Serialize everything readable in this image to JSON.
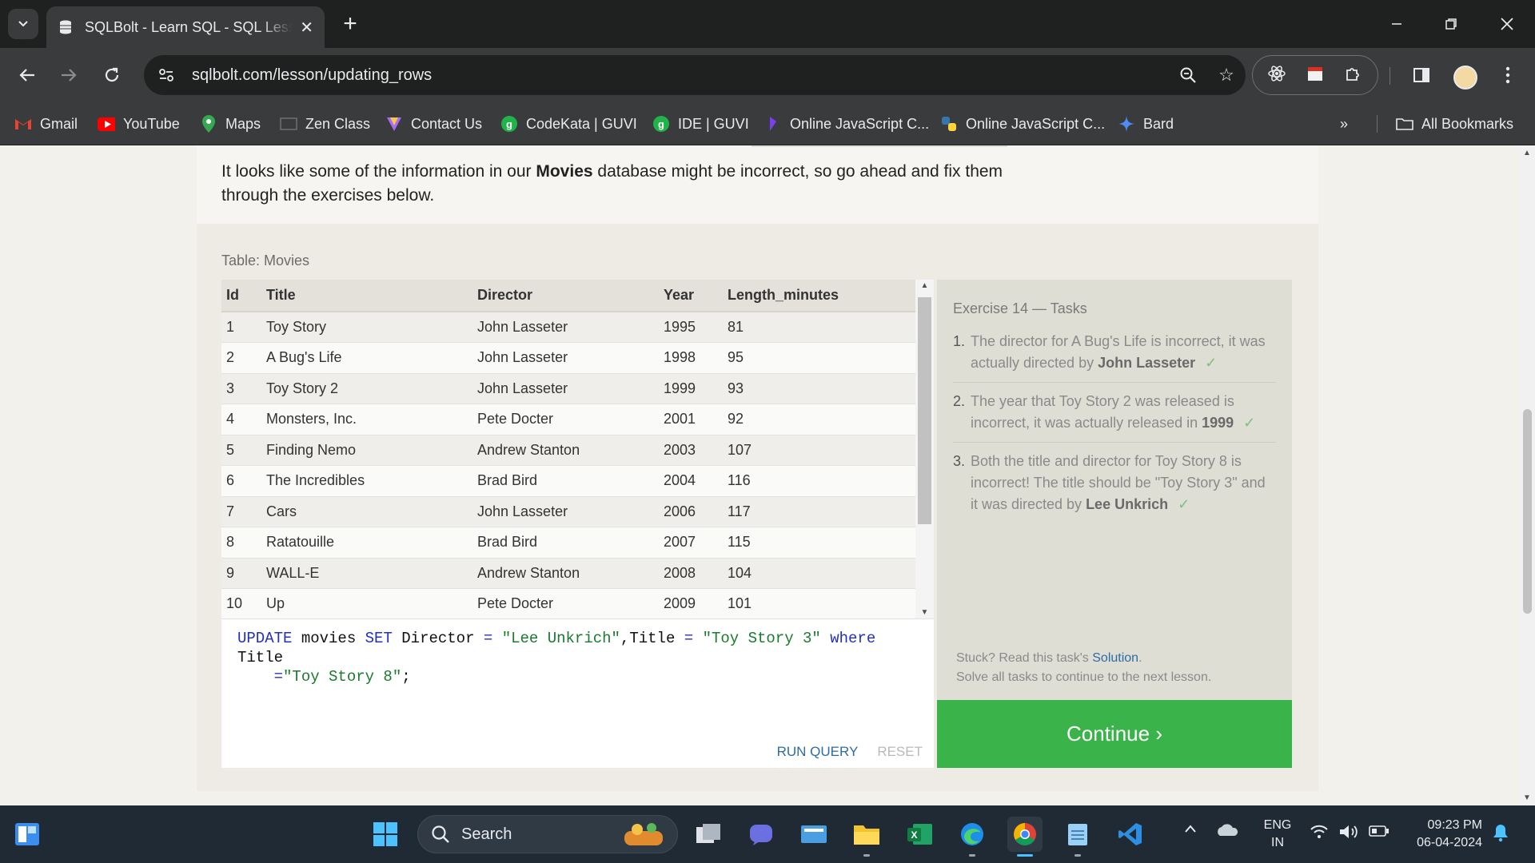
{
  "browser": {
    "tab_title": "SQLBolt - Learn SQL - SQL Lessons",
    "url": "sqlbolt.com/lesson/updating_rows"
  },
  "bookmarks": [
    {
      "label": "Gmail",
      "icon": "gmail-icon"
    },
    {
      "label": "YouTube",
      "icon": "youtube-icon"
    },
    {
      "label": "Maps",
      "icon": "maps-icon"
    },
    {
      "label": "Zen Class",
      "icon": "zen-class-icon"
    },
    {
      "label": "Contact Us",
      "icon": "contact-us-icon"
    },
    {
      "label": "CodeKata | GUVI",
      "icon": "guvi-icon"
    },
    {
      "label": "IDE | GUVI",
      "icon": "guvi-icon"
    },
    {
      "label": "Online JavaScript C...",
      "icon": "javascript-icon"
    },
    {
      "label": "Online JavaScript C...",
      "icon": "python-icon"
    },
    {
      "label": "Bard",
      "icon": "bard-icon"
    }
  ],
  "bookmarks_all": "All Bookmarks",
  "lesson": {
    "intro_before": "It looks like some of the information in our ",
    "intro_bold": "Movies",
    "intro_after": " database might be incorrect, so go ahead and fix them through the exercises below.",
    "table_caption": "Table: Movies",
    "columns": [
      "Id",
      "Title",
      "Director",
      "Year",
      "Length_minutes"
    ],
    "rows": [
      [
        "1",
        "Toy Story",
        "John Lasseter",
        "1995",
        "81"
      ],
      [
        "2",
        "A Bug's Life",
        "John Lasseter",
        "1998",
        "95"
      ],
      [
        "3",
        "Toy Story 2",
        "John Lasseter",
        "1999",
        "93"
      ],
      [
        "4",
        "Monsters, Inc.",
        "Pete Docter",
        "2001",
        "92"
      ],
      [
        "5",
        "Finding Nemo",
        "Andrew Stanton",
        "2003",
        "107"
      ],
      [
        "6",
        "The Incredibles",
        "Brad Bird",
        "2004",
        "116"
      ],
      [
        "7",
        "Cars",
        "John Lasseter",
        "2006",
        "117"
      ],
      [
        "8",
        "Ratatouille",
        "Brad Bird",
        "2007",
        "115"
      ],
      [
        "9",
        "WALL-E",
        "Andrew Stanton",
        "2008",
        "104"
      ],
      [
        "10",
        "Up",
        "Pete Docter",
        "2009",
        "101"
      ]
    ],
    "query": {
      "kw_update": "UPDATE",
      "t_movies": " movies ",
      "kw_set": "SET",
      "t_director": " Director ",
      "op1": "=",
      "s1": " \"Lee Unkrich\"",
      "t_title": ",Title ",
      "op2": "=",
      "s2": " \"Toy Story 3\"",
      "kw_where": " where",
      "t_title2": " Title\n    ",
      "op3": "=",
      "s3": "\"Toy Story 8\"",
      "t_end": ";"
    },
    "run_query": "RUN QUERY",
    "reset": "RESET",
    "exercise_title": "Exercise 14 — Tasks",
    "tasks": [
      {
        "num": "1.",
        "text": "The director for A Bug's Life is incorrect, it was actually directed by ",
        "bold": "John Lasseter",
        "check": "✓"
      },
      {
        "num": "2.",
        "text": "The year that Toy Story 2 was released is incorrect, it was actually released in ",
        "bold": "1999",
        "check": "✓"
      },
      {
        "num": "3.",
        "text": "Both the title and director for Toy Story 8 is incorrect! The title should be \"Toy Story 3\" and it was directed by ",
        "bold": "Lee Unkrich",
        "check": "✓"
      }
    ],
    "stuck_text": "Stuck? Read this task's ",
    "solution": "Solution",
    "stuck_end": ".",
    "solve_all": "Solve all tasks to continue to the next lesson.",
    "continue": "Continue ›"
  },
  "taskbar": {
    "search": "Search",
    "lang1": "ENG",
    "lang2": "IN",
    "time": "09:23 PM",
    "date": "06-04-2024"
  },
  "colors": {
    "continue_green": "#3ab44a",
    "link_blue": "#2d6ca2",
    "sql_keyword": "#2330c4",
    "sql_string": "#1a7a2e"
  }
}
